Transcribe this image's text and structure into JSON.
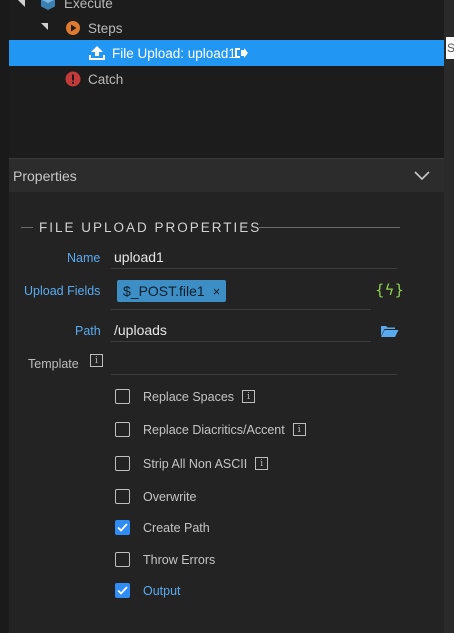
{
  "tree": {
    "execute_label": "Execute",
    "steps_label": "Steps",
    "selected_label": "File Upload: upload1",
    "catch_label": "Catch"
  },
  "right_strip_text": "S",
  "properties": {
    "header_title": "Properties",
    "section_title": "FILE UPLOAD PROPERTIES",
    "name_label": "Name",
    "name_value": "upload1",
    "upload_fields_label": "Upload Fields",
    "upload_fields_chip": "$_POST.file1",
    "chip_remove": "×",
    "dynamic_icon_text": "{ϟ}",
    "path_label": "Path",
    "path_value": "/uploads",
    "template_label": "Template",
    "info_glyph": "i"
  },
  "options": [
    {
      "label": "Replace Spaces",
      "checked": false,
      "info": true
    },
    {
      "label": "Replace Diacritics/Accent",
      "checked": false,
      "info": true
    },
    {
      "label": "Strip All Non ASCII",
      "checked": false,
      "info": true
    },
    {
      "label": "Overwrite",
      "checked": false,
      "info": false
    },
    {
      "label": "Create Path",
      "checked": true,
      "info": false
    },
    {
      "label": "Throw Errors",
      "checked": false,
      "info": false
    },
    {
      "label": "Output",
      "checked": true,
      "info": false
    }
  ],
  "colors": {
    "selection": "#2196f3",
    "accent_label": "#5aaaf0",
    "chip": "#3c8ec4",
    "checkbox_checked": "#2f8df5",
    "dynamic_icon": "#8fd14f"
  }
}
